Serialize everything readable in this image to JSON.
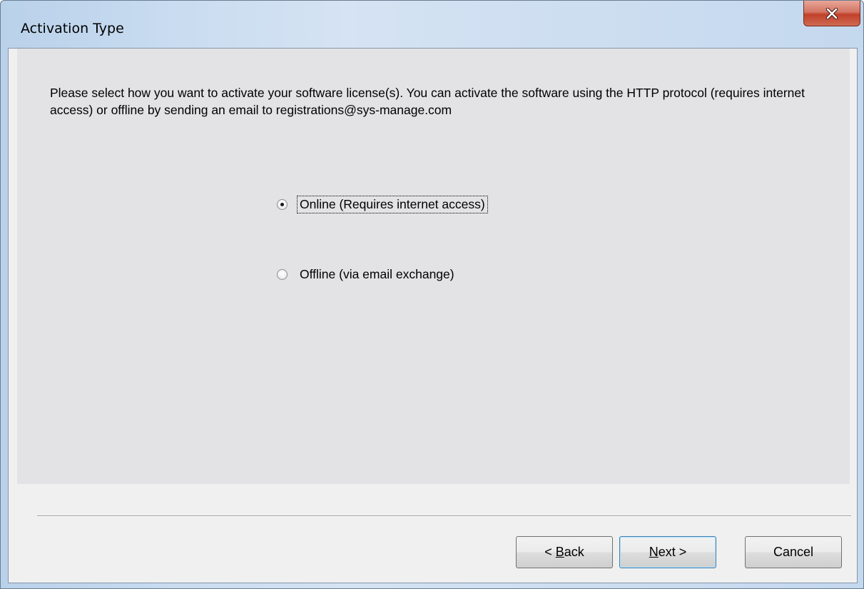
{
  "window": {
    "title": "Activation Type",
    "close_glyph": "close-icon"
  },
  "content": {
    "instructions": "Please select how you want to activate your software license(s). You can activate the software using the HTTP protocol (requires internet access) or offline by sending an email to registrations@sys-manage.com",
    "options": [
      {
        "label": "Online (Requires internet access)",
        "selected": true,
        "focused": true
      },
      {
        "label": "Offline (via email exchange)",
        "selected": false,
        "focused": false
      }
    ]
  },
  "buttons": {
    "back": {
      "prefix": "< ",
      "mnemonic": "B",
      "rest": "ack"
    },
    "next": {
      "mnemonic": "N",
      "rest": "ext >"
    },
    "cancel": {
      "label": "Cancel"
    }
  }
}
